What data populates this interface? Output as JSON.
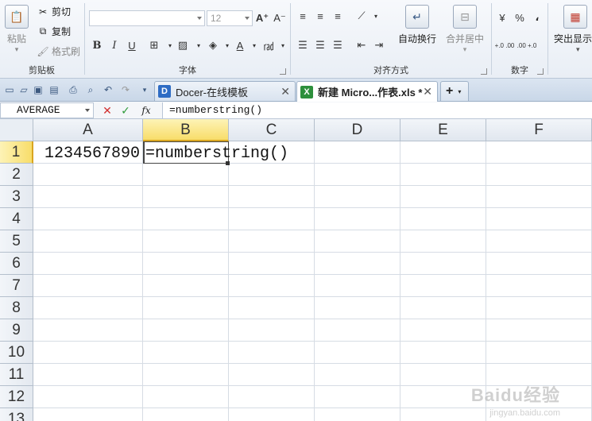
{
  "ribbon": {
    "clipboard": {
      "label": "剪贴板",
      "paste": "粘贴",
      "cut": "剪切",
      "copy": "复制",
      "format_painter": "格式刷"
    },
    "font": {
      "label": "字体",
      "name_value": "",
      "size_value": "12",
      "grow": "A⁺",
      "shrink": "A⁻",
      "bold": "B",
      "italic": "I",
      "underline": "U"
    },
    "alignment": {
      "label": "对齐方式",
      "wrap_text": "自动换行",
      "merge_center": "合并居中"
    },
    "number": {
      "label": "数字",
      "percent": "%",
      "comma": "،",
      "inc_decimal": "+.0 .00",
      "dec_decimal": ".00 +.0"
    },
    "styles": {
      "highlight": "突出显示"
    }
  },
  "tabs": [
    {
      "label": "Docer-在线模板",
      "icon": "D",
      "active": false
    },
    {
      "label": "新建 Micro...作表.xls *",
      "icon": "X",
      "active": true
    }
  ],
  "new_tab": "+",
  "formula_bar": {
    "name_box": "AVERAGE",
    "cancel": "✕",
    "confirm": "✓",
    "fx": "fx",
    "content": "=numberstring()"
  },
  "grid": {
    "columns": [
      "A",
      "B",
      "C",
      "D",
      "E",
      "F"
    ],
    "rows": [
      "1",
      "2",
      "3",
      "4",
      "5",
      "6",
      "7",
      "8",
      "9",
      "10",
      "11",
      "12",
      "13"
    ],
    "cells": {
      "A1": "1234567890",
      "B1": "=numberstring()"
    },
    "active_cell": "B1"
  },
  "watermark": {
    "brand": "Baidu经验",
    "url": "jingyan.baidu.com"
  },
  "colors": {
    "selection_header": "#f8dd6a",
    "cancel_red": "#d22f2f",
    "confirm_green": "#2e9b3a",
    "excel_green": "#2d8f3c",
    "docer_blue": "#2e6cc4"
  }
}
